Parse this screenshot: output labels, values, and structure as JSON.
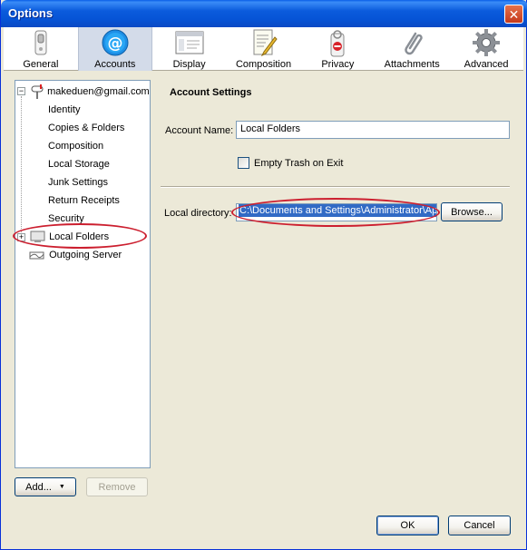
{
  "window": {
    "title": "Options"
  },
  "toolbar": {
    "items": [
      {
        "label": "General",
        "icon": "switch-icon"
      },
      {
        "label": "Accounts",
        "icon": "at-sign-icon",
        "selected": true
      },
      {
        "label": "Display",
        "icon": "window-icon"
      },
      {
        "label": "Composition",
        "icon": "pen-paper-icon"
      },
      {
        "label": "Privacy",
        "icon": "do-not-disturb-icon"
      },
      {
        "label": "Attachments",
        "icon": "paperclip-icon"
      },
      {
        "label": "Advanced",
        "icon": "gear-icon"
      }
    ]
  },
  "tree": {
    "account": "makeduen@gmail.com",
    "children": [
      "Identity",
      "Copies & Folders",
      "Composition",
      "Local Storage",
      "Junk Settings",
      "Return Receipts",
      "Security"
    ],
    "local_folders": "Local Folders",
    "outgoing_server": "Outgoing Server"
  },
  "buttons": {
    "add": "Add...",
    "remove": "Remove",
    "browse": "Browse...",
    "ok": "OK",
    "cancel": "Cancel"
  },
  "settings": {
    "title": "Account Settings",
    "account_name_label": "Account Name:",
    "account_name_value": "Local Folders",
    "empty_trash_label": "Empty Trash on Exit",
    "empty_trash_checked": false,
    "local_directory_label": "Local directory:",
    "local_directory_value": "C:\\Documents and Settings\\Administrator\\Ap"
  },
  "colors": {
    "titlebar": "#0a5fe8",
    "annotation": "#cc1f2f",
    "selection": "#316ac5"
  }
}
